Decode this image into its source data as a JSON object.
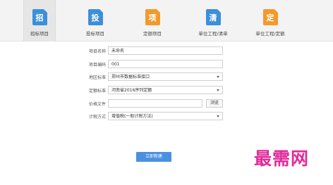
{
  "toolbar": {
    "items": [
      {
        "label": "招标项目",
        "glyph": "招",
        "color": "#3d8fd9",
        "icon": "tender-project-icon",
        "active": true
      },
      {
        "label": "投标项目",
        "glyph": "投",
        "color": "#3d8fd9",
        "icon": "bid-project-icon",
        "active": false
      },
      {
        "label": "定额项目",
        "glyph": "项",
        "color": "#f29a2e",
        "icon": "quota-project-icon",
        "active": false
      },
      {
        "label": "单位工程/清单",
        "glyph": "清",
        "color": "#3d8fd9",
        "icon": "unit-bill-icon",
        "active": false
      },
      {
        "label": "单位工程/定额",
        "glyph": "定",
        "color": "#f29a2e",
        "icon": "unit-quota-icon",
        "active": false
      }
    ]
  },
  "form": {
    "project_name_label": "项目名称",
    "project_name_value": "未命名",
    "project_code_label": "项目编码",
    "project_code_value": "001",
    "region_label": "地区标准",
    "region_value": "郑州市数据标准接口",
    "quota_label": "定额标准",
    "quota_value": "河南省2016序列定额",
    "price_file_label": "价格文件",
    "price_file_value": "",
    "browse_label": "浏览",
    "tax_label": "计税方式",
    "tax_value": "增值税(一般计税方法)",
    "submit_label": "立即新建"
  },
  "watermark": "最需网"
}
